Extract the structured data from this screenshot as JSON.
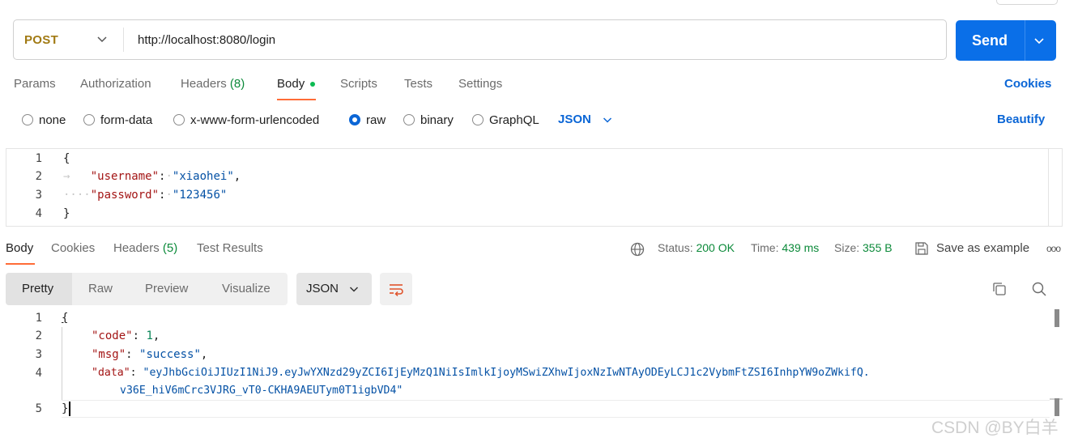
{
  "request": {
    "method": "POST",
    "url": "http://localhost:8080/login",
    "send_label": "Send"
  },
  "request_tabs": {
    "params": "Params",
    "authorization": "Authorization",
    "headers": "Headers",
    "headers_count": "(8)",
    "body": "Body",
    "scripts": "Scripts",
    "tests": "Tests",
    "settings": "Settings",
    "cookies": "Cookies"
  },
  "body_types": {
    "options": [
      "none",
      "form-data",
      "x-www-form-urlencoded",
      "raw",
      "binary",
      "GraphQL"
    ],
    "selected": "raw",
    "format": "JSON",
    "beautify": "Beautify"
  },
  "request_body": {
    "line_numbers": [
      "1",
      "2",
      "3",
      "4"
    ],
    "open_brace": "{",
    "close_brace": "}",
    "username_key": "\"username\"",
    "username_value": "\"xiaohei\"",
    "password_key": "\"password\"",
    "password_value": "\"123456\""
  },
  "response_tabs": {
    "body": "Body",
    "cookies": "Cookies",
    "headers": "Headers",
    "headers_count": "(5)",
    "test_results": "Test Results"
  },
  "response_status": {
    "status_label": "Status:",
    "status_value": "200 OK",
    "time_label": "Time:",
    "time_value": "439 ms",
    "size_label": "Size:",
    "size_value": "355 B",
    "save_as_example": "Save as example",
    "more": "ooo"
  },
  "response_view": {
    "pretty": "Pretty",
    "raw": "Raw",
    "preview": "Preview",
    "visualize": "Visualize",
    "format": "JSON"
  },
  "response_body": {
    "line_numbers": [
      "1",
      "2",
      "3",
      "4",
      "5"
    ],
    "open_brace": "{",
    "close_brace": "}",
    "code_key": "\"code\"",
    "code_value": "1",
    "msg_key": "\"msg\"",
    "msg_value": "\"success\"",
    "data_key": "\"data\"",
    "data_value_line1": "\"eyJhbGciOiJIUzI1NiJ9.eyJwYXNzd29yZCI6IjEyMzQ1NiIsImlkIjoyMSwiZXhwIjoxNzIwNTAyODEyLCJ1c2VybmFtZSI6InhpYW9oZWkifQ.",
    "data_value_line2": "v36E_hiV6mCrc3VJRG_vT0-CKHA9AEUTym0T1igbVD4\""
  },
  "watermark": "CSDN @BY白羊",
  "colors": {
    "accent_orange": "#ff6c37",
    "send_blue": "#0a6fe8",
    "link_blue": "#0b66d6",
    "status_green": "#0c8a3a",
    "method_gold": "#a17a13"
  },
  "icons": [
    "chevron-down-icon",
    "globe-icon",
    "save-icon",
    "more-icon",
    "wrap-lines-icon",
    "copy-icon",
    "search-icon"
  ]
}
